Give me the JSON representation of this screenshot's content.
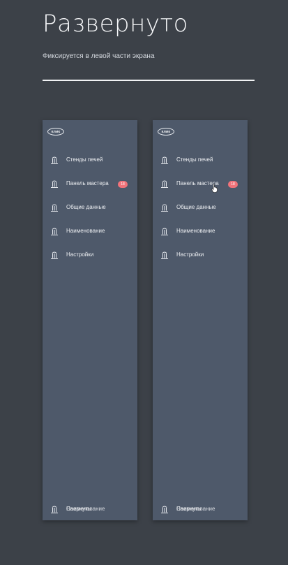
{
  "page": {
    "title": "Развернуто",
    "subtitle": "Фиксируется в левой части экрана"
  },
  "sidebar": {
    "logo_text": "КЛИК",
    "items": [
      {
        "label": "Стенды печей",
        "icon": "column-icon"
      },
      {
        "label": "Панель мастера",
        "icon": "column-icon",
        "badge": "18"
      },
      {
        "label": "Общие данные",
        "icon": "column-icon"
      },
      {
        "label": "Наименование",
        "icon": "column-icon"
      },
      {
        "label": "Настройки",
        "icon": "column-icon"
      }
    ],
    "bottom": {
      "label_a": "Свернуть",
      "label_b": "Наименование",
      "icon": "column-icon"
    }
  },
  "colors": {
    "background": "#3c4148",
    "sidebar": "#4e596a",
    "badge": "#f2737a"
  }
}
